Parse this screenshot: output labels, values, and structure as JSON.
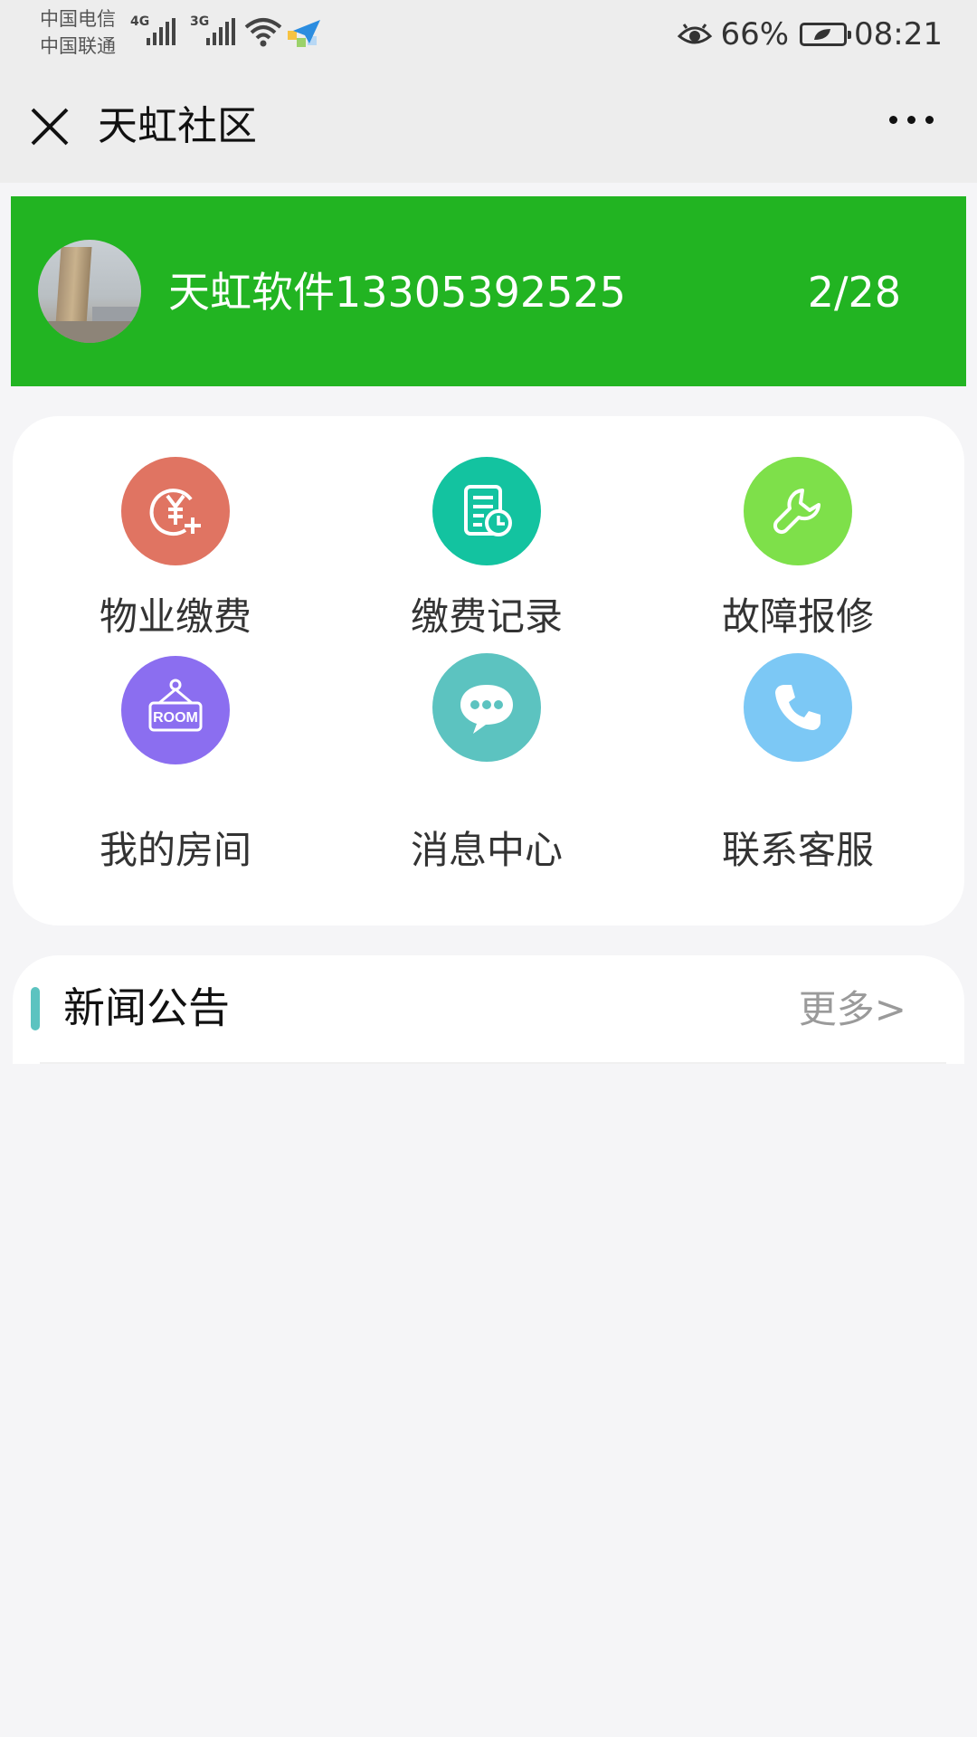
{
  "status_bar": {
    "carrier_1": "中国电信",
    "carrier_2": "中国联通",
    "net_1": "4G",
    "net_2": "3G",
    "battery_percent": "66%",
    "time": "08:21"
  },
  "nav": {
    "title": "天虹社区"
  },
  "user": {
    "name": "天虹软件13305392525",
    "date": "2/28",
    "banner_color": "#22b422"
  },
  "menu": {
    "items": [
      {
        "label": "物业缴费",
        "icon": "yuan-payment-icon",
        "color": "#e07462"
      },
      {
        "label": "缴费记录",
        "icon": "document-clock-icon",
        "color": "#13c3a0"
      },
      {
        "label": "故障报修",
        "icon": "wrench-icon",
        "color": "#7ee04a"
      },
      {
        "label": "我的房间",
        "icon": "room-sign-icon",
        "color": "#8b6ef0"
      },
      {
        "label": "消息中心",
        "icon": "chat-bubble-icon",
        "color": "#5cc3c0"
      },
      {
        "label": "联系客服",
        "icon": "phone-icon",
        "color": "#7cc8f5"
      }
    ]
  },
  "news": {
    "title": "新闻公告",
    "more": "更多>"
  }
}
